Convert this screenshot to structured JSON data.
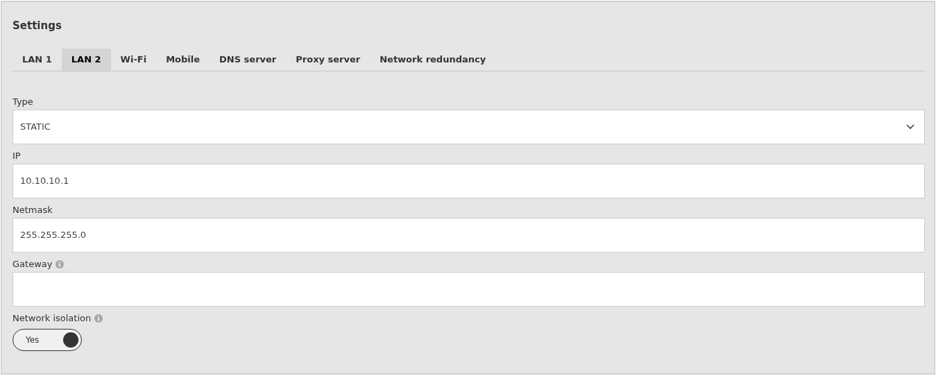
{
  "title": "Settings",
  "tabs": [
    {
      "label": "LAN 1",
      "selected": false
    },
    {
      "label": "LAN 2",
      "selected": true
    },
    {
      "label": "Wi-Fi",
      "selected": false
    },
    {
      "label": "Mobile",
      "selected": false
    },
    {
      "label": "DNS server",
      "selected": false
    },
    {
      "label": "Proxy server",
      "selected": false
    },
    {
      "label": "Network redundancy",
      "selected": false
    }
  ],
  "fields": [
    {
      "kind": "select",
      "label": "Type",
      "value": "STATIC"
    },
    {
      "kind": "text",
      "label": "IP",
      "value": "10.10.10.1"
    },
    {
      "kind": "text",
      "label": "Netmask",
      "value": "255.255.255.0"
    },
    {
      "kind": "text",
      "label": "Gateway",
      "info": true
    },
    {
      "kind": "toggle",
      "label": "Network isolation",
      "info": true,
      "on": true,
      "text": "Yes"
    }
  ]
}
